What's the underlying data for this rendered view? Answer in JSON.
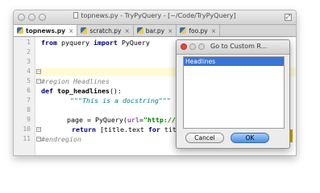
{
  "window": {
    "title": "topnews.py - TryPyQuery - [~/Code/TryPyQuery]"
  },
  "tabs": [
    {
      "label": "topnews.py"
    },
    {
      "label": "scratch.py"
    },
    {
      "label": "bar.py"
    },
    {
      "label": "foo.py"
    }
  ],
  "gutter": {
    "lines": [
      "1",
      "2",
      "3",
      "4",
      "5",
      "6",
      "7",
      "8",
      "9",
      "10",
      "11"
    ]
  },
  "code": {
    "l1": {
      "kw1": "from",
      "mod": " pyquery ",
      "kw2": "import",
      "name": " PyQuery"
    },
    "l4": "#region Headlines",
    "l5": {
      "kw": "def",
      "fn": " top_headlines",
      "rest": "():"
    },
    "l6": "\"\"\"This is a docstring\"\"\"",
    "l8": {
      "pre": "    page = PyQuery(",
      "param": "url",
      "eq": "=",
      "str": "\"http://new"
    },
    "l9": {
      "kw": "return",
      "rest": " [title.text ",
      "kw2": "for",
      "rest2": " title i"
    },
    "l10": "#endregion"
  },
  "dialog": {
    "title": "Go to Custom R...",
    "items": [
      "Headlines"
    ],
    "cancel_label": "Cancel",
    "ok_label": "OK"
  }
}
